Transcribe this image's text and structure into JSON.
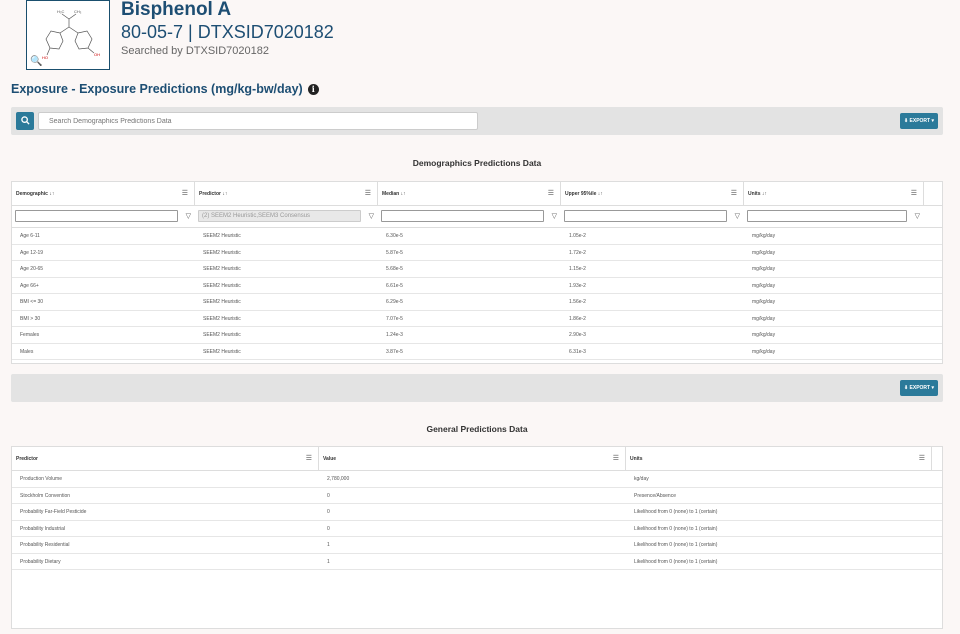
{
  "chemical": {
    "name": "Bisphenol A",
    "ids": "80-05-7 | DTXSID7020182",
    "searched_by": "Searched by DTXSID7020182"
  },
  "section": {
    "title": "Exposure - Exposure Predictions (mg/kg-bw/day)"
  },
  "search": {
    "placeholder": "Search Demographics Predictions Data"
  },
  "export_label": "EXPORT",
  "demographics": {
    "title": "Demographics Predictions Data",
    "columns": [
      "Demographic",
      "Predictor",
      "Median",
      "Upper 95%ile",
      "Units"
    ],
    "filters": [
      "",
      "(2) SEEM2 Heuristic,SEEM3 Consensus",
      "",
      "",
      ""
    ],
    "rows": [
      [
        "Age 6-11",
        "SEEM2 Heuristic",
        "6.30e-5",
        "1.05e-2",
        "mg/kg/day"
      ],
      [
        "Age 12-19",
        "SEEM2 Heuristic",
        "5.87e-5",
        "1.72e-2",
        "mg/kg/day"
      ],
      [
        "Age 20-65",
        "SEEM2 Heuristic",
        "5.68e-5",
        "1.15e-2",
        "mg/kg/day"
      ],
      [
        "Age 66+",
        "SEEM2 Heuristic",
        "6.61e-5",
        "1.93e-2",
        "mg/kg/day"
      ],
      [
        "BMI <= 30",
        "SEEM2 Heuristic",
        "6.29e-5",
        "1.56e-2",
        "mg/kg/day"
      ],
      [
        "BMI > 30",
        "SEEM2 Heuristic",
        "7.07e-5",
        "1.86e-2",
        "mg/kg/day"
      ],
      [
        "Females",
        "SEEM2 Heuristic",
        "1.24e-3",
        "2.90e-3",
        "mg/kg/day"
      ],
      [
        "Males",
        "SEEM2 Heuristic",
        "3.87e-5",
        "6.31e-3",
        "mg/kg/day"
      ]
    ]
  },
  "general": {
    "title": "General Predictions Data",
    "columns": [
      "Predictor",
      "Value",
      "Units"
    ],
    "rows": [
      [
        "Production Volume",
        "2,780,000",
        "kg/day"
      ],
      [
        "Stockholm Convention",
        "0",
        "Presence/Absence"
      ],
      [
        "Probability Far-Field Pesticide",
        "0",
        "Likelihood from 0 (none) to 1 (certain)"
      ],
      [
        "Probability Industrial",
        "0",
        "Likelihood from 0 (none) to 1 (certain)"
      ],
      [
        "Probability Residential",
        "1",
        "Likelihood from 0 (none) to 1 (certain)"
      ],
      [
        "Probability Dietary",
        "1",
        "Likelihood from 0 (none) to 1 (certain)"
      ]
    ]
  }
}
